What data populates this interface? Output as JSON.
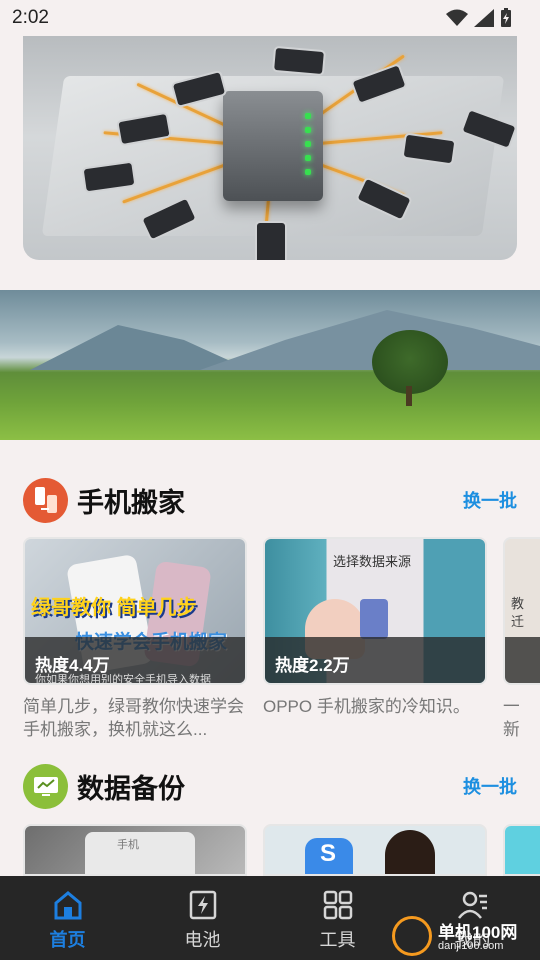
{
  "status_bar": {
    "time": "2:02"
  },
  "sections": [
    {
      "title": "手机搬家",
      "action": "换一批",
      "cards": [
        {
          "heat": "热度4.4万",
          "desc": "简单几步，绿哥教你快速学会手机搬家，换机就这么...",
          "thumb_line1": "绿哥教你  简单几步",
          "thumb_line2": "快速学会手机搬家",
          "thumb_caption": "你如果你想用别的安全手机导入数据"
        },
        {
          "heat": "热度2.2万",
          "desc": "OPPO 手机搬家的冷知识。",
          "thumb_line1": "选择数据来源"
        },
        {
          "desc": "一新",
          "thumb_line1": "教迁"
        }
      ]
    },
    {
      "title": "数据备份",
      "action": "换一批",
      "cards": [
        {
          "thumb_line1": "手机"
        },
        {
          "thumb_line1": "S"
        },
        {}
      ]
    }
  ],
  "bottom_nav": {
    "items": [
      {
        "label": "首页",
        "icon": "home-icon",
        "active": true
      },
      {
        "label": "电池",
        "icon": "battery-charge-icon",
        "active": false
      },
      {
        "label": "工具",
        "icon": "grid-tools-icon",
        "active": false
      },
      {
        "label": "我的",
        "icon": "user-icon",
        "active": false
      }
    ]
  },
  "watermark": {
    "text": "单机100网",
    "sub": "danji100.com"
  },
  "colors": {
    "accent": "#1d8fe0",
    "nav_bg": "#262626",
    "page_bg": "#f5f0f0"
  }
}
